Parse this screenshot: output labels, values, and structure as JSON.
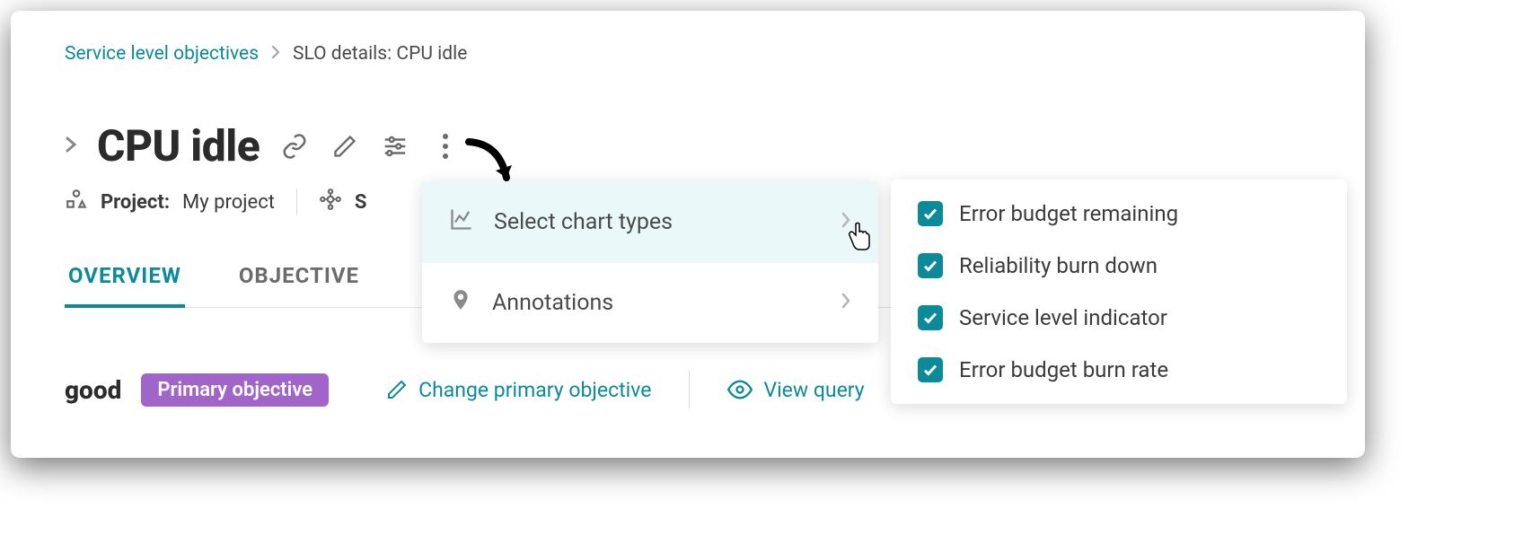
{
  "breadcrumb": {
    "root": "Service level objectives",
    "current": "SLO details: CPU idle"
  },
  "title": "CPU idle",
  "meta": {
    "project_label": "Project:",
    "project_value": "My project",
    "service_prefix": "S"
  },
  "tabs": {
    "overview": "OVERVIEW",
    "objectives": "OBJECTIVE"
  },
  "status": {
    "value": "good",
    "badge": "Primary objective",
    "change_link": "Change primary objective",
    "view_query": "View query"
  },
  "menu": {
    "select_chart_types": "Select chart types",
    "annotations": "Annotations"
  },
  "chart_options": [
    {
      "label": "Error budget remaining",
      "checked": true
    },
    {
      "label": "Reliability burn down",
      "checked": true
    },
    {
      "label": "Service level indicator",
      "checked": true
    },
    {
      "label": "Error budget burn rate",
      "checked": true
    }
  ]
}
